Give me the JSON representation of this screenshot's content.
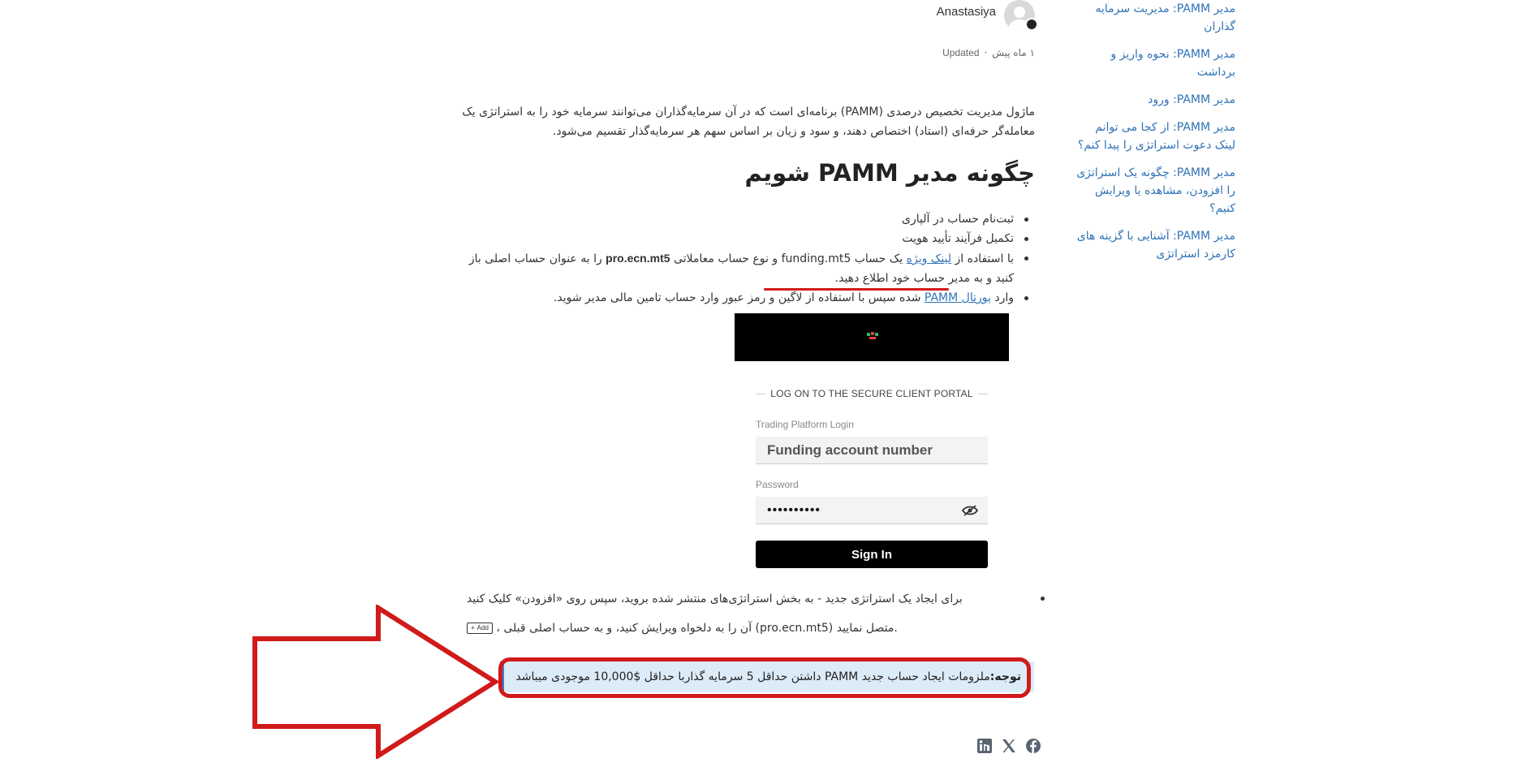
{
  "sidebar": {
    "items": [
      "مدیر PAMM: مدیریت سرمایه گذاران",
      "مدیر PAMM: نحوه واریز و برداشت",
      "مدیر PAMM: ورود",
      "مدیر PAMM: از کجا می توانم لینک دعوت استراتژی را پیدا کنم؟",
      "مدیر PAMM: چگونه یک استراتژی را افزودن، مشاهده یا ویرایش کنیم؟",
      "مدیر PAMM: آشنایی با گزینه های کارمزد استراتژی"
    ]
  },
  "author": {
    "name": "Anastasiya",
    "updated_label": "Updated",
    "separator": "·",
    "time_ago": "۱ ماه پیش"
  },
  "article": {
    "intro": "ماژول مدیریت تخصیص درصدی (PAMM) برنامه‌ای است که در آن سرمایه‌گذاران می‌توانند سرمایه خود را به استراتژی یک معامله‌گر حرفه‌ای (استاد) اختصاص دهند، و سود و زیان بر اساس سهم هر سرمایه‌گذار تقسیم می‌شود.",
    "heading": "چگونه مدیر PAMM شویم",
    "steps": {
      "s1": "ثبت‌نام حساب در آلپاری",
      "s2": "تکمیل فرآیند تأیید هویت",
      "s3_a": "با استفاده از ",
      "s3_link": "لینک ویژه",
      "s3_b": " یک حساب funding.mt5 و نوع حساب معاملاتی ",
      "s3_bold": "pro.ecn.mt5",
      "s3_c": " را به عنوان حساب اصلی باز کنید و به مدیر حساب خود اطلاع دهید.",
      "s4_a": "وارد ",
      "s4_link": "پورتال PAMM",
      "s4_b": " شده سپس با استفاده از لاگین و رمز عبور وارد حساب تامین مالی مدیر شوید."
    },
    "steps2": {
      "s5": "برای ایجاد یک استراتژی جدید - به بخش استراتژی‌های منتشر شده بروید، سپس روی «افزودن» کلیک کنید",
      "s6": " ، آن را به دلخواه ویرایش کنید، و به حساب اصلی قبلی (pro.ecn.mt5) متصل نمایید.",
      "add_chip": "Add"
    }
  },
  "portal": {
    "title": "LOG ON TO THE SECURE CLIENT PORTAL",
    "login_label": "Trading Platform Login",
    "login_value": "Funding account number",
    "password_label": "Password",
    "password_value": "••••••••••",
    "sign_in": "Sign In"
  },
  "notice": {
    "label": "توجه:",
    "text": "ملزومات ایجاد حساب جدید PAMM داشتن حداقل 5 سرمایه گذاربا حداقل $10,000 موجودی میباشد"
  },
  "social": {
    "icons": [
      "facebook-icon",
      "x-icon",
      "linkedin-icon"
    ]
  },
  "colors": {
    "link": "#2f72b6",
    "highlight": "#d11a1a",
    "notice_bg": "#dcebf8",
    "notice_border": "#3b7dd8"
  }
}
